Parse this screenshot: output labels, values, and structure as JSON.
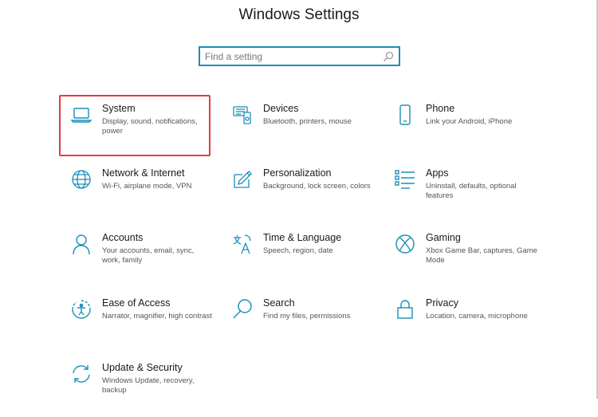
{
  "window": {
    "title": "Windows Settings"
  },
  "search": {
    "placeholder": "Find a setting"
  },
  "colors": {
    "accent": "#1a8fb9",
    "highlight": "#e03e3e"
  },
  "tiles": [
    {
      "name": "System",
      "desc": "Display, sound, notifications, power",
      "icon": "laptop-icon",
      "selected": true
    },
    {
      "name": "Devices",
      "desc": "Bluetooth, printers, mouse",
      "icon": "devices-icon"
    },
    {
      "name": "Phone",
      "desc": "Link your Android, iPhone",
      "icon": "phone-icon"
    },
    {
      "name": "Network & Internet",
      "desc": "Wi-Fi, airplane mode, VPN",
      "icon": "globe-icon"
    },
    {
      "name": "Personalization",
      "desc": "Background, lock screen, colors",
      "icon": "personalization-icon"
    },
    {
      "name": "Apps",
      "desc": "Uninstall, defaults, optional features",
      "icon": "apps-list-icon"
    },
    {
      "name": "Accounts",
      "desc": "Your accounts, email, sync, work, family",
      "icon": "person-icon"
    },
    {
      "name": "Time & Language",
      "desc": "Speech, region, date",
      "icon": "time-language-icon"
    },
    {
      "name": "Gaming",
      "desc": "Xbox Game Bar, captures, Game Mode",
      "icon": "xbox-icon"
    },
    {
      "name": "Ease of Access",
      "desc": "Narrator, magnifier, high contrast",
      "icon": "ease-of-access-icon"
    },
    {
      "name": "Search",
      "desc": "Find my files, permissions",
      "icon": "magnifier-icon"
    },
    {
      "name": "Privacy",
      "desc": "Location, camera, microphone",
      "icon": "lock-icon"
    },
    {
      "name": "Update & Security",
      "desc": "Windows Update, recovery, backup",
      "icon": "sync-icon"
    }
  ]
}
